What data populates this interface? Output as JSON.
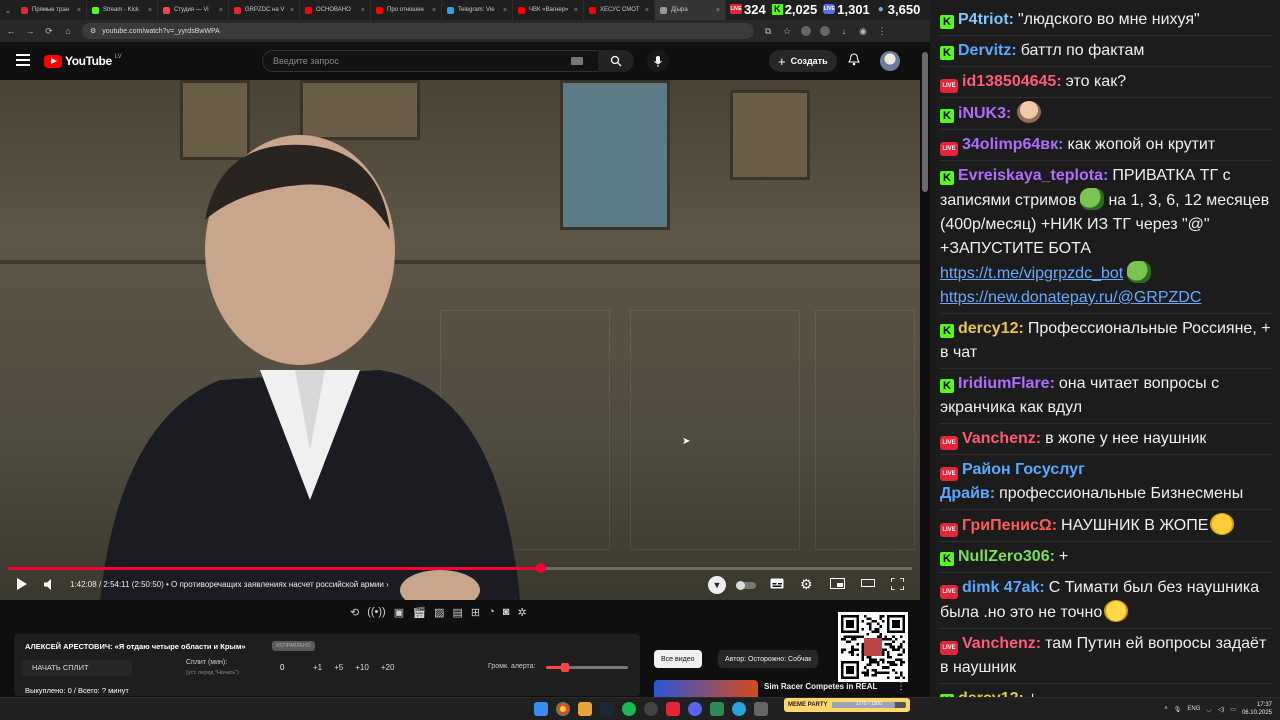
{
  "browser": {
    "tabs": [
      {
        "label": "Прямые тран",
        "color": "#e5253a"
      },
      {
        "label": "Stream - Kick",
        "color": "#53fc18"
      },
      {
        "label": "Студия — Vi",
        "color": "#ff4444"
      },
      {
        "label": "GRPZDC на V",
        "color": "#e5253a"
      },
      {
        "label": "ОСНОВАНО",
        "color": "#ff0000"
      },
      {
        "label": "Про отношен",
        "color": "#ff0000"
      },
      {
        "label": "Telegram: Vie",
        "color": "#2aa3df"
      },
      {
        "label": "ЧВК «Вагнер»",
        "color": "#ff0000"
      },
      {
        "label": "ХЕСУС СМОТ",
        "color": "#ff0000"
      },
      {
        "label": "Д[ыра",
        "color": "#999999"
      }
    ],
    "url": "youtube.com/watch?v=_yyrdsBwWPA"
  },
  "stream_stats": {
    "live_viewers": "324",
    "kick_viewers": "2,025",
    "vk_viewers": "1,301",
    "total_viewers": "3,650",
    "live_badge": "LIVE",
    "vk_badge": "LIVE"
  },
  "youtube": {
    "logo": "YouTube",
    "region": "LV",
    "search_placeholder": "Введите запрос",
    "create_label": "Создать",
    "icons": [
      "menu-icon",
      "search-icon",
      "mic-icon",
      "bell-icon",
      "plus-icon"
    ]
  },
  "player": {
    "current_time": "1:42:08",
    "duration": "2:54:11",
    "adjusted_time": "(2:50:50)",
    "chapter": "О противоречащих заявлениях насчет российской армии",
    "progress": 0.59,
    "controls": [
      "play-icon",
      "volume-icon",
      "autoplay-toggle",
      "subtitles-icon",
      "settings-icon",
      "miniplayer-icon",
      "theater-icon",
      "fullscreen-icon"
    ]
  },
  "split_panel": {
    "title": "АЛЕКСЕЙ АРЕСТОВИЧ: «Я отдаю четыре области и Крым»",
    "tag": "ИСПРАВЛЕНО",
    "start_label": "НАЧАТЬ СПЛИТ",
    "split_label": "Сплит (мин):",
    "split_hint": "(уст. перед \"Начать\")",
    "split_value": "0",
    "increments": [
      "+1",
      "+5",
      "+10",
      "+20"
    ],
    "alert_label": "Громк. алерта:",
    "bought_label": "Выкуплено: 0 / Всего: ? минут",
    "alert_volume": 0.18
  },
  "related": {
    "tab_all": "Все видео",
    "tab_author": "Автор: Осторожно: Собчак",
    "item_title": "Sim Racer Competes in REAL"
  },
  "chat": [
    {
      "badge": "kick",
      "nick": "P4triot:",
      "color": "#7cc8ff",
      "text": "\"людского во мне нихуя\""
    },
    {
      "badge": "kick",
      "nick": "Dervitz:",
      "color": "#5aa9ff",
      "text": "баттл по фактам"
    },
    {
      "badge": "live",
      "nick": "id138504645:",
      "color": "#ff5a76",
      "text": "это как?"
    },
    {
      "badge": "kick",
      "nick": "iNUK3:",
      "color": "#b06cff",
      "text": "",
      "emote": "face"
    },
    {
      "badge": "live",
      "nick": "34olimp64вк:",
      "color": "#b06cff",
      "text": "как жопой он крутит"
    },
    {
      "badge": "kick",
      "nick": "Evreiskaya_teplota:",
      "color": "#b06cff",
      "text": "ПРИВАТКА ТГ с записями стримов",
      "text2": "на 1, 3, 6, 12 месяцев (400р/месяц) +НИК ИЗ ТГ через \"@\" +ЗАПУСТИТЕ БОТА",
      "link1": "https://t.me/vipgrpzdc_bot",
      "link2": "https://new.donatepay.ru/@GRPZDC"
    },
    {
      "badge": "kick",
      "nick": "dercy12:",
      "color": "#e6c84a",
      "text": "Профессиональные Россияне, + в чат"
    },
    {
      "badge": "kick",
      "nick": "IridiumFlare:",
      "color": "#b06cff",
      "text": "она читает вопросы с экранчика как вдул"
    },
    {
      "badge": "live",
      "nick": "Vanchenz:",
      "color": "#ff5a76",
      "text": "в жопе у нее наушник"
    },
    {
      "badge": "live",
      "nick": "Район Госуслуг Драйв:",
      "color": "#5aa9ff",
      "text": "профессиональные Бизнесмены"
    },
    {
      "badge": "live",
      "nick": "ГриПенисΩ:",
      "color": "#ff5a5a",
      "text": "НАУШНИК В ЖОПЕ",
      "emote": "starstruck"
    },
    {
      "badge": "kick",
      "nick": "NullZero306:",
      "color": "#7dde5a",
      "text": "+"
    },
    {
      "badge": "live",
      "nick": "dimk 47ak:",
      "color": "#5aa9ff",
      "text": "С Тимати был без наушника была .но это не точно",
      "emote": "tears"
    },
    {
      "badge": "live",
      "nick": "Vanchenz:",
      "color": "#ff5a76",
      "text": "там Путин ей вопросы задаёт в наушник"
    },
    {
      "badge": "kick",
      "nick": "dercy12:",
      "color": "#e6c84a",
      "text": "+"
    }
  ],
  "taskbar": {
    "lang": "ENG",
    "time": "17:37",
    "date": "06.10.2025",
    "mem_label": "MEME PARTY",
    "mem_value": "1275 / 1500",
    "mem_fraction": 0.85
  }
}
